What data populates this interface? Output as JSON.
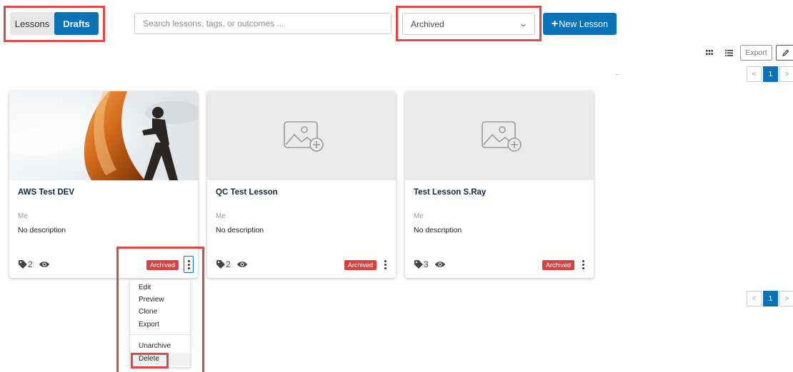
{
  "toolbar": {
    "toggle": {
      "lessons_label": "Lessons",
      "drafts_label": "Drafts",
      "active": "Drafts"
    },
    "search": {
      "placeholder": "Search lessons, tags, or outcomes ...",
      "value": ""
    },
    "filter_select": {
      "value": "Archived"
    },
    "new_lesson_label": "New Lesson",
    "export_label": "Export",
    "accent_color": "#0a73b7"
  },
  "pagination": {
    "prev": "<",
    "current": "1",
    "next": ">"
  },
  "cards": [
    {
      "title": "AWS Test DEV",
      "author": "Me",
      "description": "No description",
      "tag_count": "2",
      "status": "Archived",
      "has_image": true
    },
    {
      "title": "QC Test Lesson",
      "author": "Me",
      "description": "No description",
      "tag_count": "2",
      "status": "Archived",
      "has_image": false
    },
    {
      "title": "Test Lesson S.Ray",
      "author": "Me",
      "description": "No description",
      "tag_count": "3",
      "status": "Archived",
      "has_image": false
    }
  ],
  "menu": {
    "items": [
      "Edit",
      "Preview",
      "Clone",
      "Export"
    ],
    "secondary": [
      "Unarchive",
      "Delete"
    ]
  },
  "icons": {
    "grid_view": "grid-icon",
    "list_view": "list-icon",
    "edit": "pencil-icon",
    "tag": "tag-icon",
    "views": "eye-icon",
    "placeholder": "image-add-icon",
    "more": "kebab-icon",
    "dropdown": "chevron-down-icon"
  },
  "colors": {
    "badge": "#d94141",
    "annotation": "#e04848"
  }
}
